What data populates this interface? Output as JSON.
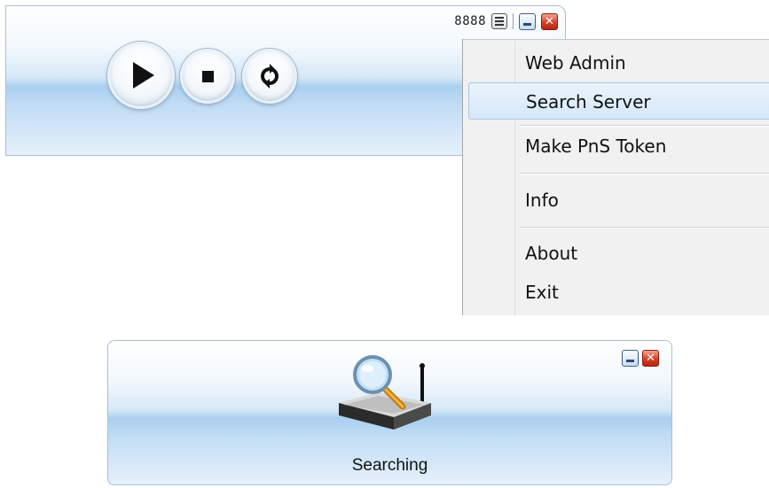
{
  "player": {
    "port": "8888",
    "icons": {
      "menu": "hamburger-menu-icon",
      "minimize": "minimize-icon",
      "close": "close-icon",
      "play": "play-icon",
      "stop": "stop-icon",
      "refresh": "refresh-icon"
    }
  },
  "context_menu": {
    "items": [
      {
        "label": "Web Admin"
      },
      {
        "label": "Search Server",
        "highlighted": true
      },
      {
        "label": "Make PnS Token"
      },
      {
        "label": "Info"
      },
      {
        "label": "About"
      },
      {
        "label": "Exit"
      }
    ]
  },
  "search_window": {
    "status": "Searching",
    "icon": "router-magnifier-icon"
  },
  "colors": {
    "window_blue": "#aacff0",
    "close_red": "#d6402a",
    "menu_bg": "#f1f1f1",
    "highlight": "#d6e7f8"
  }
}
